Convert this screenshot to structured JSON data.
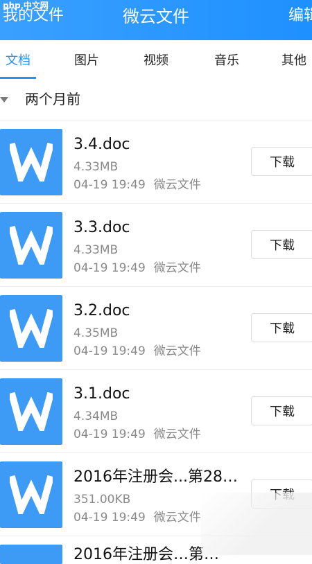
{
  "header": {
    "left_text": "我的文件",
    "title": "微云文件",
    "right_text": "编辑",
    "logo_text": "php 中文网",
    "bg_color": "#1e90ff"
  },
  "tabs": [
    {
      "label": "文档",
      "active": true
    },
    {
      "label": "图片",
      "active": false
    },
    {
      "label": "视频",
      "active": false
    },
    {
      "label": "音乐",
      "active": false
    },
    {
      "label": "其他",
      "active": false
    }
  ],
  "section": {
    "title": "两个月前"
  },
  "files": [
    {
      "name": "3.4.doc",
      "size": "4.33MB",
      "date": "04-19 19:49",
      "source": "微云文件",
      "download_label": "下载",
      "icon": "word-icon"
    },
    {
      "name": "3.3.doc",
      "size": "4.33MB",
      "date": "04-19 19:49",
      "source": "微云文件",
      "download_label": "下载",
      "icon": "word-icon"
    },
    {
      "name": "3.2.doc",
      "size": "4.35MB",
      "date": "04-19 19:49",
      "source": "微云文件",
      "download_label": "下载",
      "icon": "word-icon"
    },
    {
      "name": "3.1.doc",
      "size": "4.34MB",
      "date": "04-19 19:49",
      "source": "微云文件",
      "download_label": "下载",
      "icon": "word-icon"
    },
    {
      "name": "2016年注册会...第28…",
      "size": "351.00KB",
      "date": "04-19 19:49",
      "source": "微云文件",
      "download_label": "下载",
      "icon": "word-icon"
    }
  ],
  "partial_item": {
    "name": "2016年注册会…第…"
  },
  "colors": {
    "accent": "#2b8ff2",
    "icon_bg": "#3d9bf5",
    "muted_text": "#8a8a8a"
  }
}
